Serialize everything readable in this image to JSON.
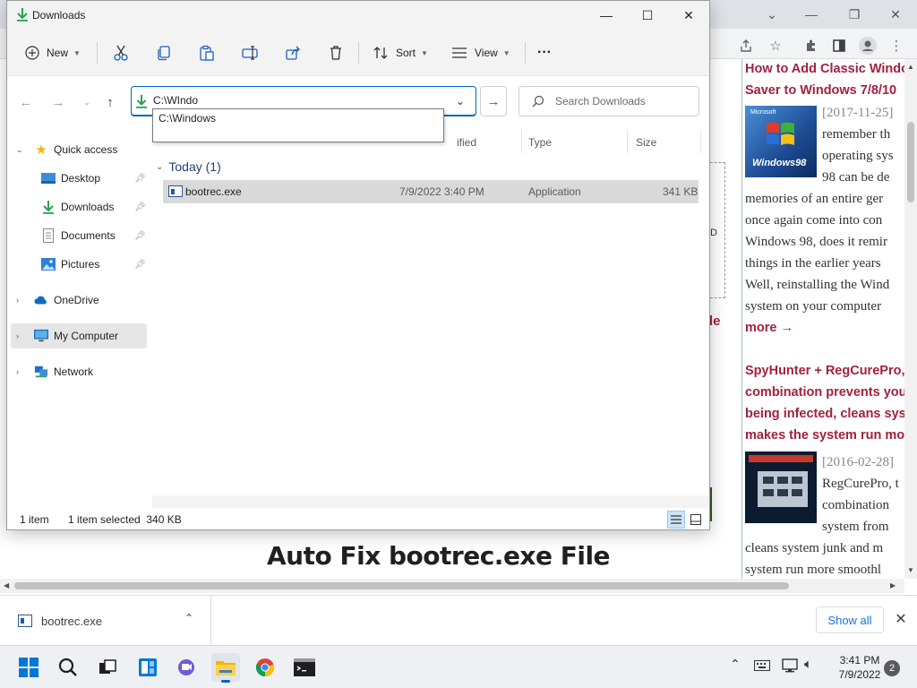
{
  "explorer": {
    "title": "Downloads",
    "command_bar": {
      "new_label": "New",
      "sort_label": "Sort",
      "view_label": "View",
      "more_label": "···"
    },
    "address_value": "C:\\WIndo",
    "autocomplete_item": "C:\\Windows",
    "search_placeholder": "Search Downloads",
    "navigation": [
      {
        "label": "Quick access"
      },
      {
        "label": "Desktop"
      },
      {
        "label": "Downloads"
      },
      {
        "label": "Documents"
      },
      {
        "label": "Pictures"
      },
      {
        "label": "OneDrive"
      },
      {
        "label": "My Computer"
      },
      {
        "label": "Network"
      }
    ],
    "columns": {
      "modified": "ified",
      "type": "Type",
      "size": "Size"
    },
    "group_label": "Today (1)",
    "files": [
      {
        "name": "bootrec.exe",
        "date": "7/9/2022 3:40 PM",
        "type": "Application",
        "size": "341 KB"
      }
    ],
    "status": {
      "count": "1 item",
      "selection": "1 item selected  340 KB"
    }
  },
  "page": {
    "sidebar": {
      "article1_title_line1": "How to Add Classic Windo",
      "article1_title_line2": "Saver to Windows 7/8/10",
      "article1_date": "[2017-11-25]",
      "article1_lines": [
        "remember th",
        "operating sys",
        "98 can be de",
        "memories of an entire ger",
        "once again come into con",
        "Windows 98, does it remir",
        "things in the earlier years",
        "Well, reinstalling the Wind",
        "system on your computer"
      ],
      "more_label": "more →",
      "article2_title_lines": [
        "SpyHunter + RegCurePro,",
        "combination prevents you",
        "being infected, cleans syst",
        "makes the system run mo"
      ],
      "article2_date": "[2016-02-28]",
      "article2_lines": [
        "RegCurePro, t",
        "combination",
        "system from",
        "cleans system junk and m",
        "system run more smoothl"
      ],
      "thumb1_label": "Windows98",
      "thumb1_small": "Microsoft"
    },
    "heading": "Auto Fix bootrec.exe File",
    "fragment_1": "le",
    "fragment_2": "D"
  },
  "download_bar": {
    "file_name": "bootrec.exe",
    "show_all_label": "Show all"
  },
  "taskbar": {
    "time": "3:41 PM",
    "date": "7/9/2022",
    "notification_count": "2"
  },
  "colors": {
    "accent": "#0067c0",
    "link_red": "#a3213c",
    "group_header": "#1f3f7a"
  }
}
